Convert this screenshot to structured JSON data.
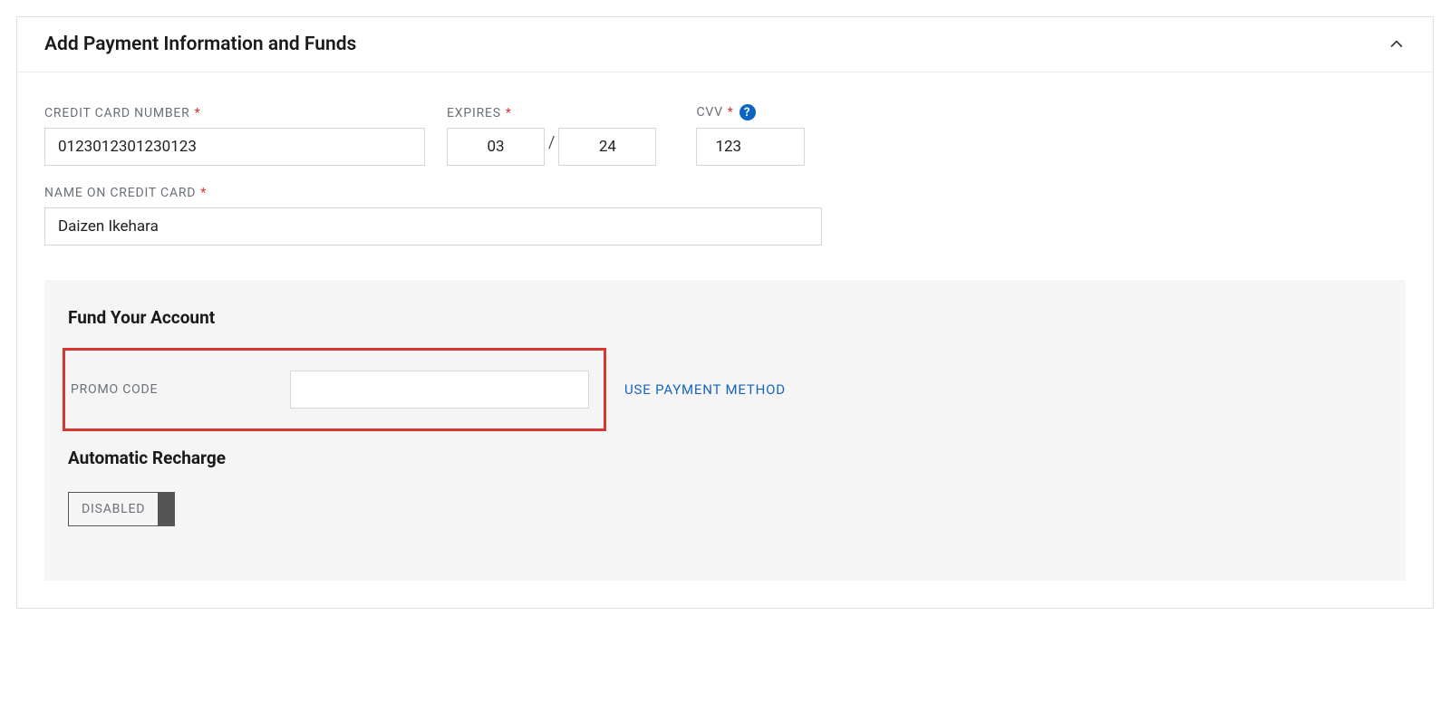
{
  "panel": {
    "title": "Add Payment Information and Funds"
  },
  "form": {
    "cc_number_label": "Credit Card Number",
    "cc_number_value": "0123012301230123",
    "expires_label": "Expires",
    "expires_month": "03",
    "expires_year": "24",
    "cvv_label": "CVV",
    "cvv_value": "123",
    "name_label": "Name on Credit Card",
    "name_value": "Daizen Ikehara"
  },
  "fund": {
    "title": "Fund Your Account",
    "promo_label": "Promo Code",
    "promo_value": "",
    "use_payment_link": "Use Payment Method",
    "recharge_title": "Automatic Recharge",
    "recharge_state": "Disabled"
  }
}
